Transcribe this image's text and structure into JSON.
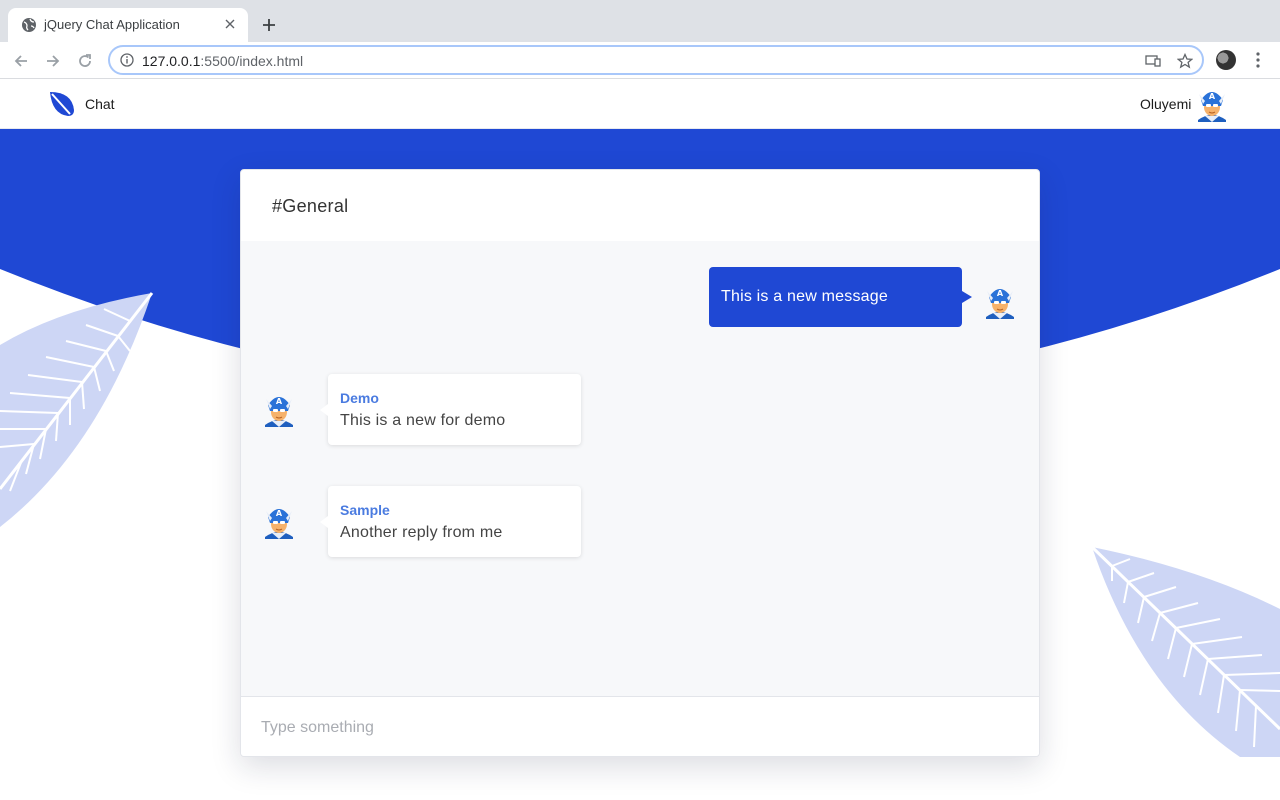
{
  "browser": {
    "tab_title": "jQuery Chat Application",
    "url_host": "127.0.0.1",
    "url_rest": ":5500/index.html"
  },
  "app": {
    "brand": "Chat",
    "username": "Oluyemi",
    "channel": "#General",
    "composer_placeholder": "Type something",
    "accent_color": "#1f48d4",
    "sender_color": "#4a7be0"
  },
  "messages": [
    {
      "direction": "outgoing",
      "text": "This is a new message"
    },
    {
      "direction": "incoming",
      "sender": "Demo",
      "text": "This is a new for demo"
    },
    {
      "direction": "incoming",
      "sender": "Sample",
      "text": "Another reply from me"
    }
  ]
}
